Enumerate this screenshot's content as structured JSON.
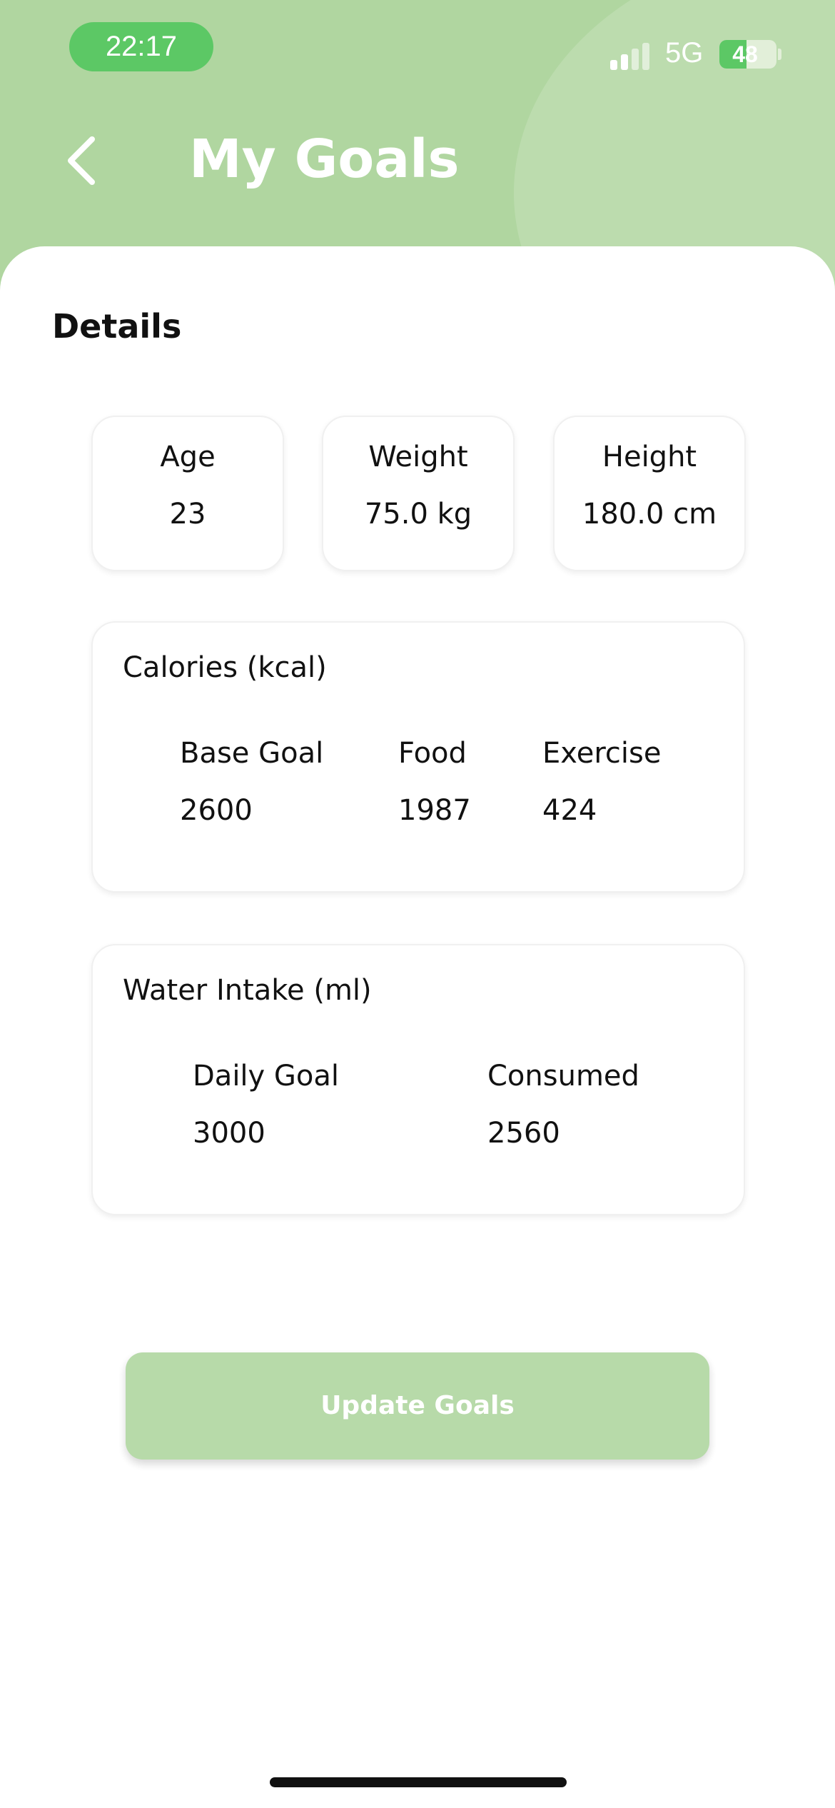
{
  "status_bar": {
    "time": "22:17",
    "network": "5G",
    "battery": "48"
  },
  "header": {
    "title": "My Goals"
  },
  "details": {
    "title": "Details",
    "stats": [
      {
        "label": "Age",
        "value": "23"
      },
      {
        "label": "Weight",
        "value": "75.0 kg"
      },
      {
        "label": "Height",
        "value": "180.0 cm"
      }
    ]
  },
  "calories": {
    "title": "Calories (kcal)",
    "columns": [
      {
        "label": "Base Goal",
        "value": "2600"
      },
      {
        "label": "Food",
        "value": "1987"
      },
      {
        "label": "Exercise",
        "value": "424"
      }
    ]
  },
  "water": {
    "title": "Water Intake (ml)",
    "columns": [
      {
        "label": "Daily Goal",
        "value": "3000"
      },
      {
        "label": "Consumed",
        "value": "2560"
      }
    ]
  },
  "actions": {
    "update_label": "Update Goals"
  },
  "colors": {
    "header_green": "#b0d6a0",
    "pill_green": "#5cc865"
  }
}
